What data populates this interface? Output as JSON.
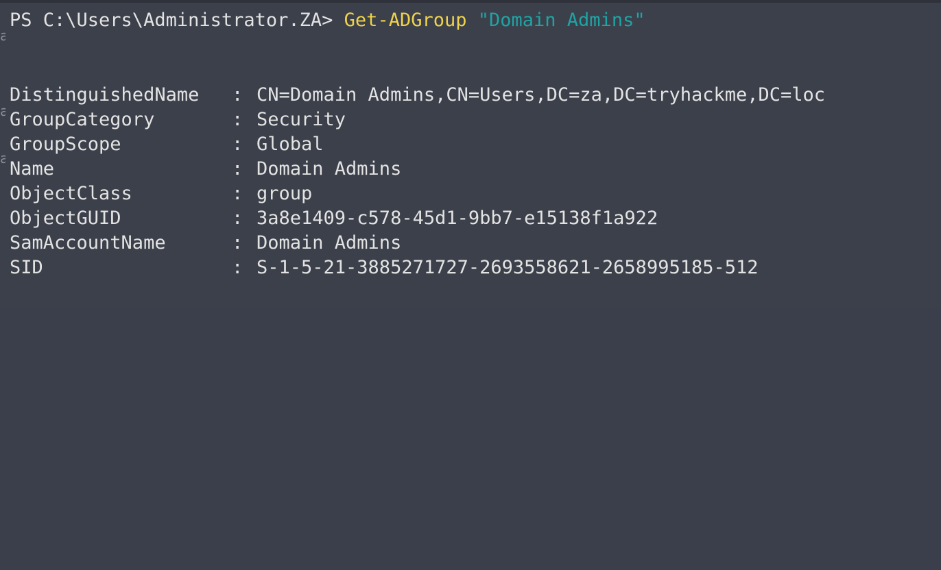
{
  "console": {
    "prompt": "PS C:\\Users\\Administrator.ZA>",
    "command": "Get-ADGroup",
    "argument": "\"Domain Admins\"",
    "gutter_glyph": "a",
    "properties": [
      {
        "key": "DistinguishedName",
        "value": "CN=Domain Admins,CN=Users,DC=za,DC=tryhackme,DC=loc"
      },
      {
        "key": "GroupCategory",
        "value": "Security"
      },
      {
        "key": "GroupScope",
        "value": "Global"
      },
      {
        "key": "Name",
        "value": "Domain Admins"
      },
      {
        "key": "ObjectClass",
        "value": "group"
      },
      {
        "key": "ObjectGUID",
        "value": "3a8e1409-c578-45d1-9bb7-e15138f1a922"
      },
      {
        "key": "SamAccountName",
        "value": "Domain Admins"
      },
      {
        "key": "SID",
        "value": "S-1-5-21-3885271727-2693558621-2658995185-512"
      }
    ],
    "separator": ":"
  },
  "colors": {
    "background": "#3c404b",
    "text": "#e3e3e3",
    "command": "#f0d34a",
    "string": "#1fa4a4"
  }
}
